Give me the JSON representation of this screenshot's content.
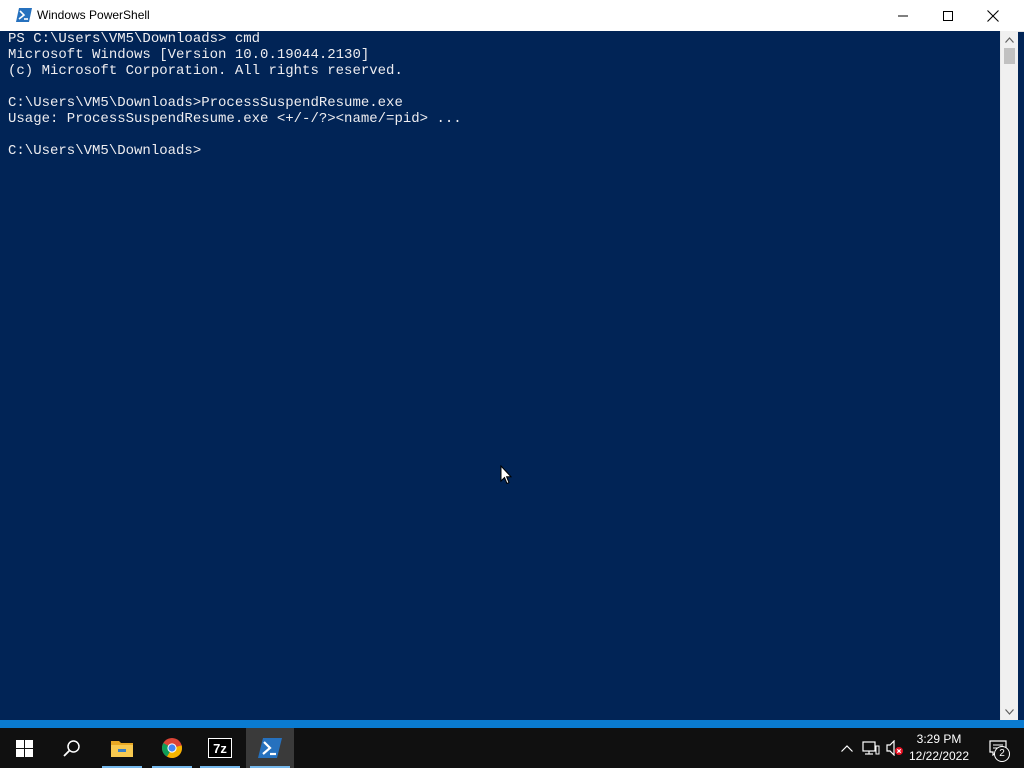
{
  "window": {
    "title": "Windows PowerShell",
    "colors": {
      "console_bg": "#012456",
      "console_fg": "#eeedf0"
    }
  },
  "console": {
    "lines": [
      "PS C:\\Users\\VM5\\Downloads> cmd",
      "Microsoft Windows [Version 10.0.19044.2130]",
      "(c) Microsoft Corporation. All rights reserved.",
      "",
      "C:\\Users\\VM5\\Downloads>ProcessSuspendResume.exe",
      "Usage: ProcessSuspendResume.exe <+/-/?><name/=pid> ...",
      "",
      "C:\\Users\\VM5\\Downloads>"
    ]
  },
  "taskbar": {
    "items": [
      {
        "name": "start",
        "icon": "windows-logo-icon"
      },
      {
        "name": "search",
        "icon": "search-icon"
      },
      {
        "name": "file-explorer",
        "icon": "folder-icon"
      },
      {
        "name": "chrome",
        "icon": "chrome-icon"
      },
      {
        "name": "7-zip",
        "icon": "7zip-icon",
        "label": "7z"
      },
      {
        "name": "powershell",
        "icon": "powershell-icon"
      }
    ],
    "tray": {
      "time": "3:29 PM",
      "date": "12/22/2022",
      "notification_count": "2"
    }
  }
}
